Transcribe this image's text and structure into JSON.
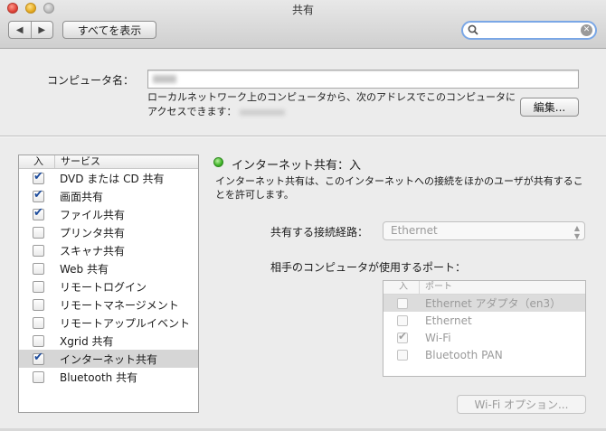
{
  "window": {
    "title": "共有"
  },
  "toolbar": {
    "back_glyph": "◀",
    "forward_glyph": "▶",
    "show_all_label": "すべてを表示",
    "search_placeholder": "",
    "clear_glyph": "✕"
  },
  "computer_name": {
    "label": "コンピュータ名：",
    "value": "",
    "description": "ローカルネットワーク上のコンピュータから、次のアドレスでこのコンピュータにアクセスできます：",
    "edit_label": "編集..."
  },
  "services": {
    "header_on": "入",
    "header_service": "サービス",
    "items": [
      {
        "label": "DVD または CD 共有",
        "checked": true
      },
      {
        "label": "画面共有",
        "checked": true
      },
      {
        "label": "ファイル共有",
        "checked": true
      },
      {
        "label": "プリンタ共有",
        "checked": false
      },
      {
        "label": "スキャナ共有",
        "checked": false
      },
      {
        "label": "Web 共有",
        "checked": false
      },
      {
        "label": "リモートログイン",
        "checked": false
      },
      {
        "label": "リモートマネージメント",
        "checked": false
      },
      {
        "label": "リモートアップルイベント",
        "checked": false
      },
      {
        "label": "Xgrid 共有",
        "checked": false
      },
      {
        "label": "インターネット共有",
        "checked": true,
        "selected": true
      },
      {
        "label": "Bluetooth 共有",
        "checked": false
      }
    ]
  },
  "detail": {
    "status_title": "インターネット共有：入",
    "status_color": "#3fb428",
    "description": "インターネット共有は、このインターネットへの接続をほかのユーザが共有することを許可します。",
    "share_via_label": "共有する接続経路：",
    "share_via_value": "Ethernet",
    "ports_label": "相手のコンピュータが使用するポート：",
    "ports_header_on": "入",
    "ports_header_port": "ポート",
    "ports": [
      {
        "label": "Ethernet アダプタ（en3）",
        "checked": false,
        "selected": true
      },
      {
        "label": "Ethernet",
        "checked": false
      },
      {
        "label": "Wi-Fi",
        "checked": true
      },
      {
        "label": "Bluetooth PAN",
        "checked": false
      }
    ],
    "wifi_options_label": "Wi-Fi オプション..."
  }
}
